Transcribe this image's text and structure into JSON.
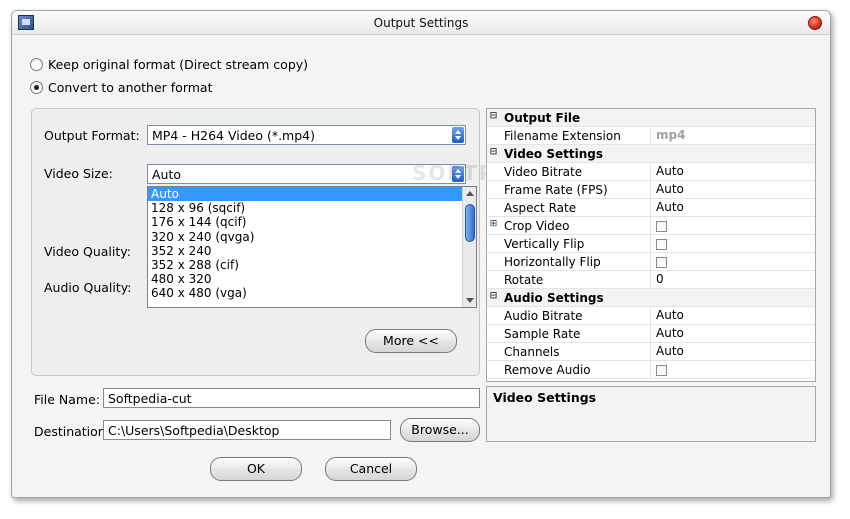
{
  "window": {
    "title": "Output Settings"
  },
  "format_options": {
    "keep_original": "Keep original format (Direct stream copy)",
    "convert": "Convert to another format",
    "selected": "convert"
  },
  "labels": {
    "output_format": "Output Format:",
    "video_size": "Video Size:",
    "video_quality": "Video Quality:",
    "audio_quality": "Audio Quality:",
    "file_name": "File Name:",
    "destination": "Destination:"
  },
  "output_format": {
    "value": "MP4 - H264 Video (*.mp4)"
  },
  "video_size": {
    "value": "Auto",
    "options": [
      "Auto",
      "128 x 96 (sqcif)",
      "176 x 144 (qcif)",
      "320 x 240 (qvga)",
      "352 x 240",
      "352 x 288 (cif)",
      "480 x 320",
      "640 x 480 (vga)"
    ]
  },
  "buttons": {
    "more": "More <<",
    "browse": "Browse...",
    "ok": "OK",
    "cancel": "Cancel"
  },
  "file_name": {
    "value": "Softpedia-cut"
  },
  "destination": {
    "value": "C:\\Users\\Softpedia\\Desktop"
  },
  "properties": {
    "output_file": {
      "title": "Output File",
      "filename_extension_label": "Filename Extension",
      "filename_extension_value": "mp4"
    },
    "video_settings": {
      "title": "Video Settings",
      "video_bitrate_label": "Video Bitrate",
      "video_bitrate_value": "Auto",
      "frame_rate_label": "Frame Rate (FPS)",
      "frame_rate_value": "Auto",
      "aspect_rate_label": "Aspect Rate",
      "aspect_rate_value": "Auto",
      "crop_video_label": "Crop Video",
      "vertically_flip_label": "Vertically Flip",
      "horizontally_flip_label": "Horizontally Flip",
      "rotate_label": "Rotate",
      "rotate_value": "0"
    },
    "audio_settings": {
      "title": "Audio Settings",
      "audio_bitrate_label": "Audio Bitrate",
      "audio_bitrate_value": "Auto",
      "sample_rate_label": "Sample Rate",
      "sample_rate_value": "Auto",
      "channels_label": "Channels",
      "channels_value": "Auto",
      "remove_audio_label": "Remove Audio"
    }
  },
  "description": {
    "title": "Video Settings"
  },
  "watermark": "SOFTPE"
}
